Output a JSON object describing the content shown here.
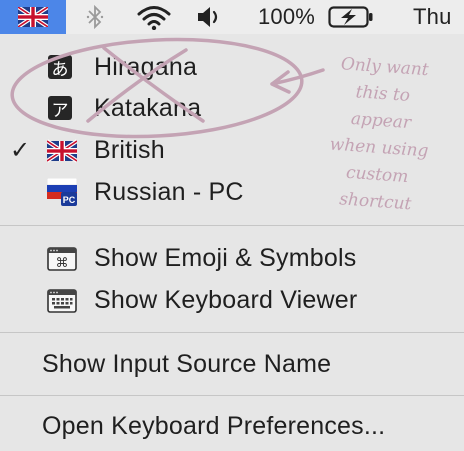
{
  "menubar": {
    "battery_percent": "100%",
    "clock_day": "Thu",
    "icons": [
      "uk-flag-icon",
      "bluetooth-icon",
      "wifi-icon",
      "volume-icon",
      "battery-charging-icon"
    ]
  },
  "menu": {
    "input_sources": [
      {
        "label": "Hiragana",
        "icon": "hiragana-icon",
        "glyph": "あ",
        "checked": false
      },
      {
        "label": "Katakana",
        "icon": "katakana-icon",
        "glyph": "ア",
        "checked": false
      },
      {
        "label": "British",
        "icon": "uk-flag-icon",
        "checked": true,
        "check_mark": "✓"
      },
      {
        "label": "Russian - PC",
        "icon": "russia-flag-icon",
        "badge": "PC",
        "checked": false
      }
    ],
    "tools": [
      {
        "label": "Show Emoji & Symbols",
        "icon": "emoji-symbols-icon"
      },
      {
        "label": "Show Keyboard Viewer",
        "icon": "keyboard-viewer-icon"
      }
    ],
    "show_input_source_name": "Show Input Source Name",
    "open_keyboard_preferences": "Open Keyboard Preferences..."
  },
  "annotation": {
    "lines": [
      "Only want",
      "this to",
      "appear",
      "when using",
      "custom",
      "shortcut"
    ],
    "color": "#c4a3b4"
  }
}
